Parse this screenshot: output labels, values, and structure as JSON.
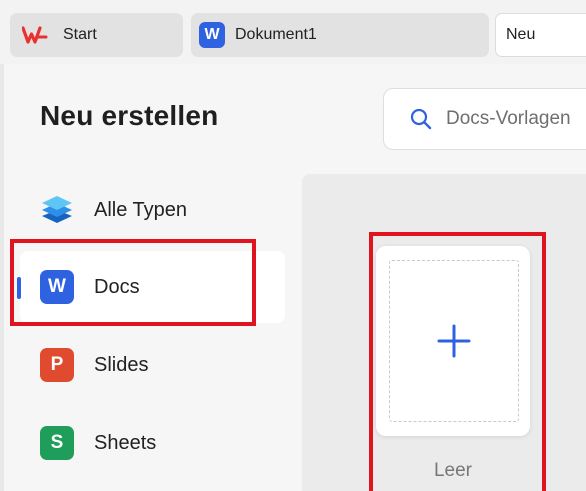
{
  "tabs": {
    "start_label": "Start",
    "document_label": "Dokument1",
    "new_label": "Neu",
    "document_icon_letter": "W"
  },
  "panel": {
    "title": "Neu erstellen"
  },
  "search": {
    "placeholder": "Docs-Vorlagen"
  },
  "sidebar": {
    "items": [
      {
        "label": "Alle Typen",
        "icon": "layers-icon",
        "active": false
      },
      {
        "label": "Docs",
        "icon": "docs-app-icon",
        "icon_letter": "W",
        "color": "#2f62e0",
        "active": true
      },
      {
        "label": "Slides",
        "icon": "slides-app-icon",
        "icon_letter": "P",
        "color": "#e04a2f",
        "active": false
      },
      {
        "label": "Sheets",
        "icon": "sheets-app-icon",
        "icon_letter": "S",
        "color": "#1e9e5a",
        "active": false
      }
    ]
  },
  "templates": {
    "blank_caption": "Leer",
    "plus_icon": "plus-icon"
  },
  "colors": {
    "accent": "#2f62e0",
    "highlight": "#e0141e",
    "wps_red": "#e8312f"
  }
}
